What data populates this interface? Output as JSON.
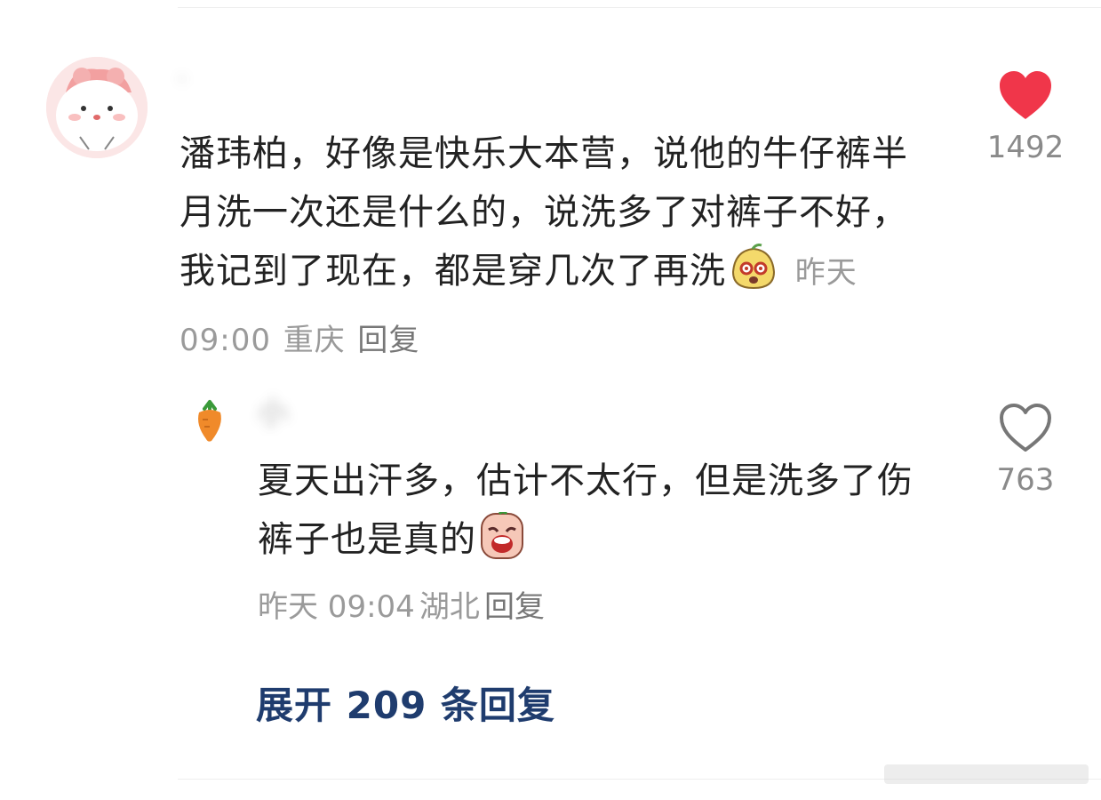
{
  "comment": {
    "username": "·",
    "text": "潘玮柏，好像是快乐大本营，说他的牛仔裤半月洗一次还是什么的，说洗多了对裤子不好，我记到了现在，都是穿几次了再洗",
    "time": "昨天 09:00",
    "location": "重庆",
    "reply_label": "回复",
    "likes": "1492",
    "liked": true
  },
  "reply": {
    "username": "小",
    "text": "夏天出汗多，估计不太行，但是洗多了伤裤子也是真的",
    "time": "昨天 09:04",
    "location": "湖北",
    "reply_label": "回复",
    "likes": "763",
    "liked": false
  },
  "expand_label": "展开 209 条回复",
  "colors": {
    "like_active": "#f0364a",
    "like_inactive": "#777777",
    "expand_link": "#1f3c6e",
    "meta_text": "#9a9a9a"
  }
}
